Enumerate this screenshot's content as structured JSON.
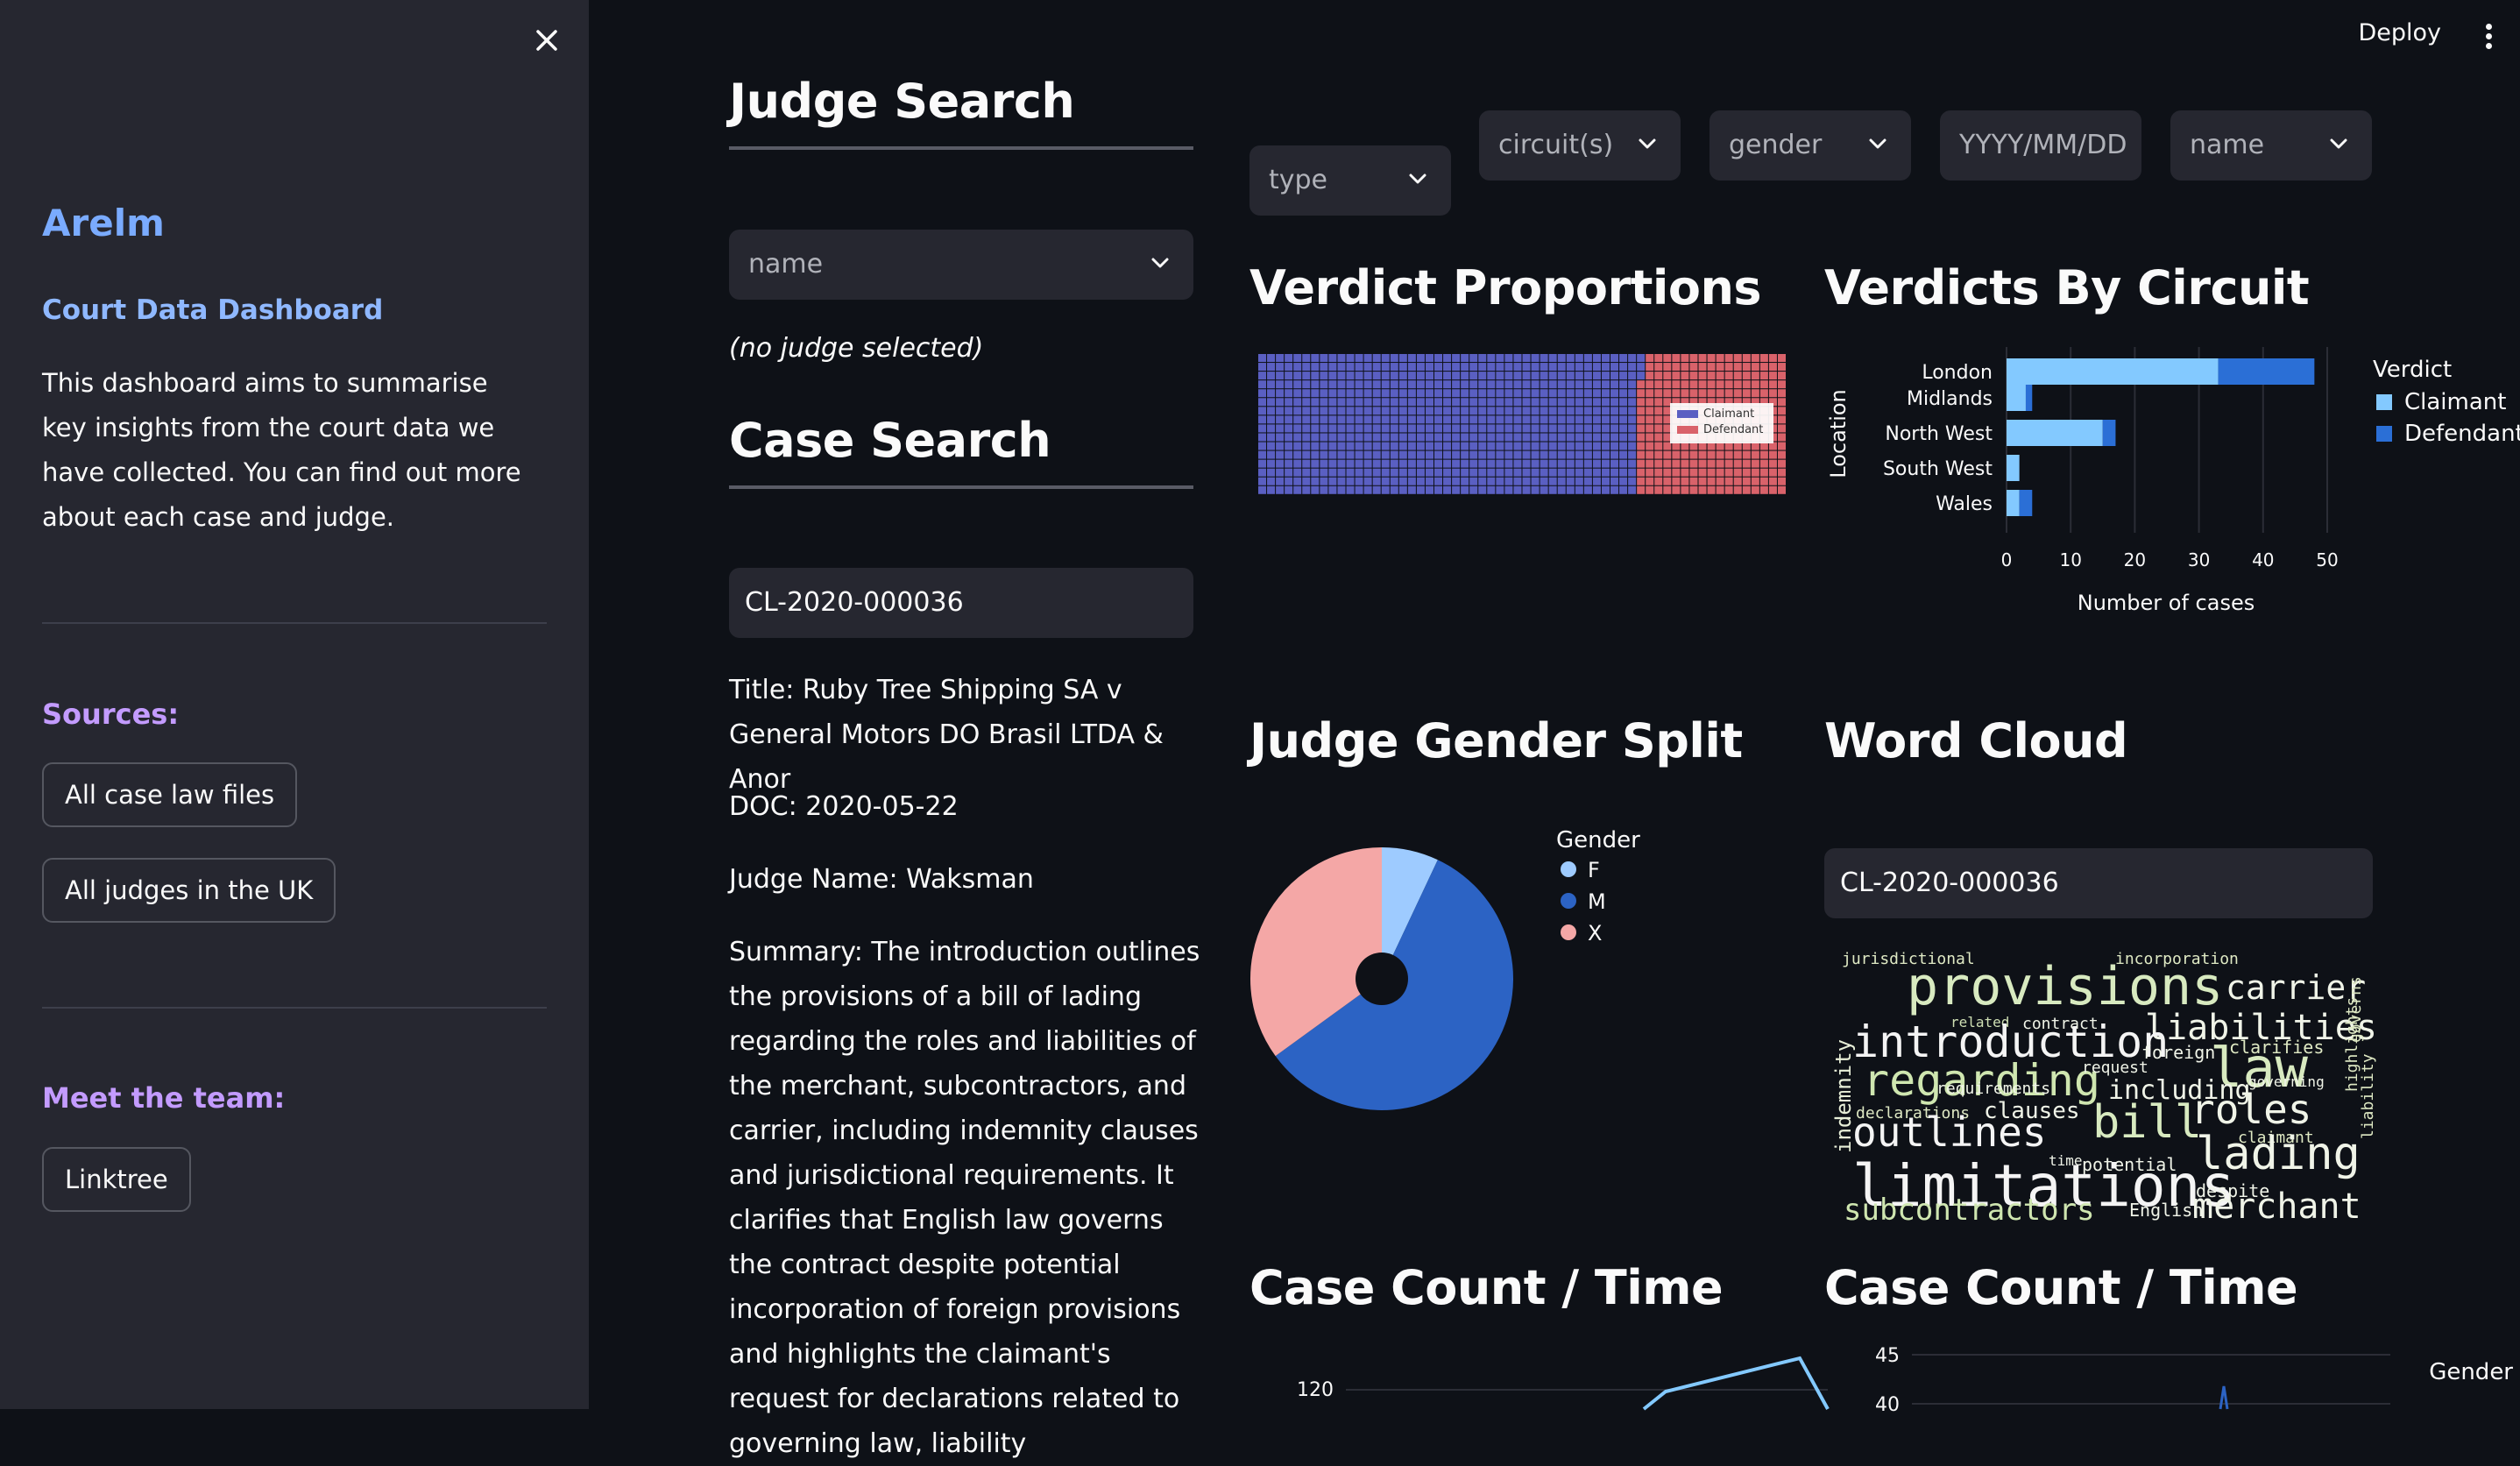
{
  "sidebar": {
    "title": "Arelm",
    "subtitle": "Court Data Dashboard",
    "description": "This dashboard aims to summarise key insights from the court data we have collected. You can find out more about each case and judge.",
    "sources_heading": "Sources:",
    "sources_buttons": [
      "All case law files",
      "All judges in the UK"
    ],
    "team_heading": "Meet the team:",
    "team_button": "Linktree"
  },
  "header": {
    "deploy_label": "Deploy"
  },
  "judge_search": {
    "heading": "Judge Search",
    "select_placeholder": "name",
    "empty_caption": "(no judge selected)"
  },
  "case_search": {
    "heading": "Case Search",
    "input_value": "CL-2020-000036",
    "title_line": "Title: Ruby Tree Shipping SA v General Motors DO Brasil LTDA & Anor",
    "doc_line": "DOC: 2020-05-22",
    "judge_line": "Judge Name: Waksman",
    "summary_line": "Summary: The introduction outlines the provisions of a bill of lading regarding the roles and liabilities of the merchant, subcontractors, and carrier, including indemnity clauses and jurisdictional requirements. It clarifies that English law governs the contract despite potential incorporation of foreign provisions and highlights the claimant's request for declarations related to governing law, liability"
  },
  "filters": {
    "type": "type",
    "circuits": "circuit(s)",
    "gender": "gender",
    "date": "YYYY/MM/DD",
    "name": "name"
  },
  "verdict_proportions": {
    "heading": "Verdict Proportions",
    "legend": [
      "Claimant",
      "Defendant"
    ],
    "colors": {
      "Claimant": "#5a5fc2",
      "Defendant": "#d9626a"
    }
  },
  "verdicts_by_circuit": {
    "heading": "Verdicts By Circuit",
    "legend_title": "Verdict",
    "legend": [
      "Claimant",
      "Defendant"
    ],
    "colors": {
      "Claimant": "#83c9ff",
      "Defendant": "#2b6fd6"
    }
  },
  "gender_split": {
    "heading": "Judge Gender Split",
    "legend_title": "Gender",
    "legend": [
      "F",
      "M",
      "X"
    ],
    "colors": {
      "F": "#9ecbff",
      "M": "#2c63c4",
      "X": "#f4a7a6"
    }
  },
  "word_cloud": {
    "heading": "Word Cloud",
    "input_value": "CL-2020-000036",
    "words": [
      "jurisdictional",
      "incorporation",
      "provisions",
      "carrier",
      "related",
      "contract",
      "liabilities",
      "indemnity",
      "introduction",
      "foreign",
      "clarifies",
      "law",
      "regarding",
      "request",
      "including",
      "governing",
      "highlights",
      "requirements",
      "liability",
      "governs",
      "declarations",
      "clauses",
      "outlines",
      "bill",
      "roles",
      "claimant",
      "time",
      "potential",
      "lading",
      "limitations",
      "despite",
      "subcontractors",
      "English",
      "merchant"
    ]
  },
  "case_count_left": {
    "heading": "Case Count / Time",
    "tick": "120"
  },
  "case_count_right": {
    "heading": "Case Count / Time",
    "ticks": [
      "45",
      "40"
    ],
    "legend_title": "Gender"
  },
  "chart_data": [
    {
      "type": "waffle",
      "title": "Verdict Proportions",
      "categories": [
        "Claimant",
        "Defendant"
      ],
      "values": [
        0.72,
        0.28
      ]
    },
    {
      "type": "bar",
      "orientation": "horizontal",
      "stacked": true,
      "title": "Verdicts By Circuit",
      "categories": [
        "London",
        "Midlands",
        "North West",
        "South West",
        "Wales"
      ],
      "series": [
        {
          "name": "Claimant",
          "values": [
            33,
            3,
            15,
            2,
            2
          ]
        },
        {
          "name": "Defendant",
          "values": [
            15,
            1,
            2,
            0,
            2
          ]
        }
      ],
      "xlabel": "Number of cases",
      "ylabel": "Location",
      "xticks": [
        0,
        10,
        20,
        30,
        40,
        50
      ],
      "xlim": [
        0,
        50
      ],
      "legend_title": "Verdict",
      "legend_position": "right",
      "grid": true
    },
    {
      "type": "pie",
      "donut": true,
      "title": "Judge Gender Split",
      "categories": [
        "F",
        "M",
        "X"
      ],
      "values": [
        7,
        58,
        35
      ],
      "legend_title": "Gender",
      "legend_position": "top-right"
    }
  ]
}
